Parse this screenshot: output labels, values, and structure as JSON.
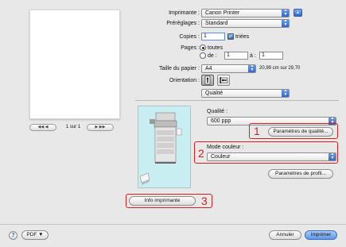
{
  "preview": {
    "page_indicator": "1 sur 1",
    "first_icon": "◀◀",
    "prev_icon": "◀",
    "next_icon": "▶",
    "last_icon": "▶▶"
  },
  "printer": {
    "label": "Imprimante :",
    "value": "Canon Printer",
    "arrow_icon": "▲"
  },
  "presets": {
    "label": "Préréglages :",
    "value": "Standard"
  },
  "copies": {
    "label": "Copies :",
    "value": "1",
    "sorted_label": "triées",
    "sorted_checked": true
  },
  "pages": {
    "label": "Pages :",
    "all_label": "toutes",
    "from_label": "de :",
    "from_value": "1",
    "to_label": "à :",
    "to_value": "1"
  },
  "paper": {
    "label": "Taille du papier :",
    "value": "A4",
    "dimensions": "20,99 cm sur 29,70"
  },
  "orientation": {
    "label": "Orientation :"
  },
  "section_popup": {
    "value": "Qualité"
  },
  "quality": {
    "label": "Qualité :",
    "value": "600 ppp",
    "settings_button": "Paramètres de qualité..."
  },
  "color_mode": {
    "label": "Mode couleur :",
    "value": "Couleur"
  },
  "profile_button": "Paramètres de profil...",
  "printer_info_button": "Info imprimante",
  "callouts": [
    "1",
    "2",
    "3"
  ],
  "footer": {
    "help_icon": "?",
    "pdf_label": "PDF ▼",
    "cancel_label": "Annuler",
    "print_label": "Imprimer"
  },
  "colors": {
    "callout": "#d42020",
    "preview_bg": "#c8eef2",
    "default_button": "#6aa3e8"
  }
}
